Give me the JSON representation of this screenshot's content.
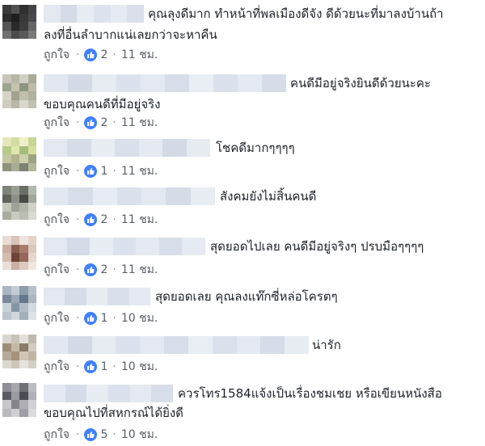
{
  "like_label": "ถูกใจ",
  "dot": "·",
  "colors": {
    "like_icon": "#4080ff",
    "text": "#1d2129",
    "meta": "#5a5f67"
  },
  "comments": [
    {
      "line1": "คุณลุงดีมาก ทำหน้าที่พลเมืองดีจัง ดีด้วยนะที่มาลงบ้านถ้า",
      "line2": "ลงที่อื่นลำบากแน่เลยกว่าจะหาคืน",
      "likes": "2",
      "time": "11 ชม."
    },
    {
      "line1": "คนดีมีอยู่จริงยินดีด้วยนะคะ",
      "line2": "ขอบคุณคนดีที่มีอยู่จริง",
      "likes": "2",
      "time": "11 ชม."
    },
    {
      "line1": "โชคดีมากๆๆๆๆ",
      "line2": "",
      "likes": "1",
      "time": "11 ชม."
    },
    {
      "line1": "สังคมยังไม่สิ้นคนดี",
      "line2": "",
      "likes": "2",
      "time": "11 ชม."
    },
    {
      "line1": "สุดยอดไปเลย คนดีมีอยู่จริงๆ ปรบมือๆๆๆๆ",
      "line2": "",
      "likes": "2",
      "time": "11 ชม."
    },
    {
      "line1": "สุดยอดเลย คุณลงแท๊กซี่หล่อโครตๆ",
      "line2": "",
      "likes": "1",
      "time": "10 ชม."
    },
    {
      "line1": "น่ารัก",
      "line2": "",
      "likes": "1",
      "time": "10 ชม."
    },
    {
      "line1": "ควรโทร1584แจ้งเป็นเรื่องชมเชย หรือเขียนหนังสือ",
      "line2": "ขอบคุณไปที่สหกรณ์ได้ยิ่งดี",
      "likes": "5",
      "time": "10 ชม."
    }
  ]
}
